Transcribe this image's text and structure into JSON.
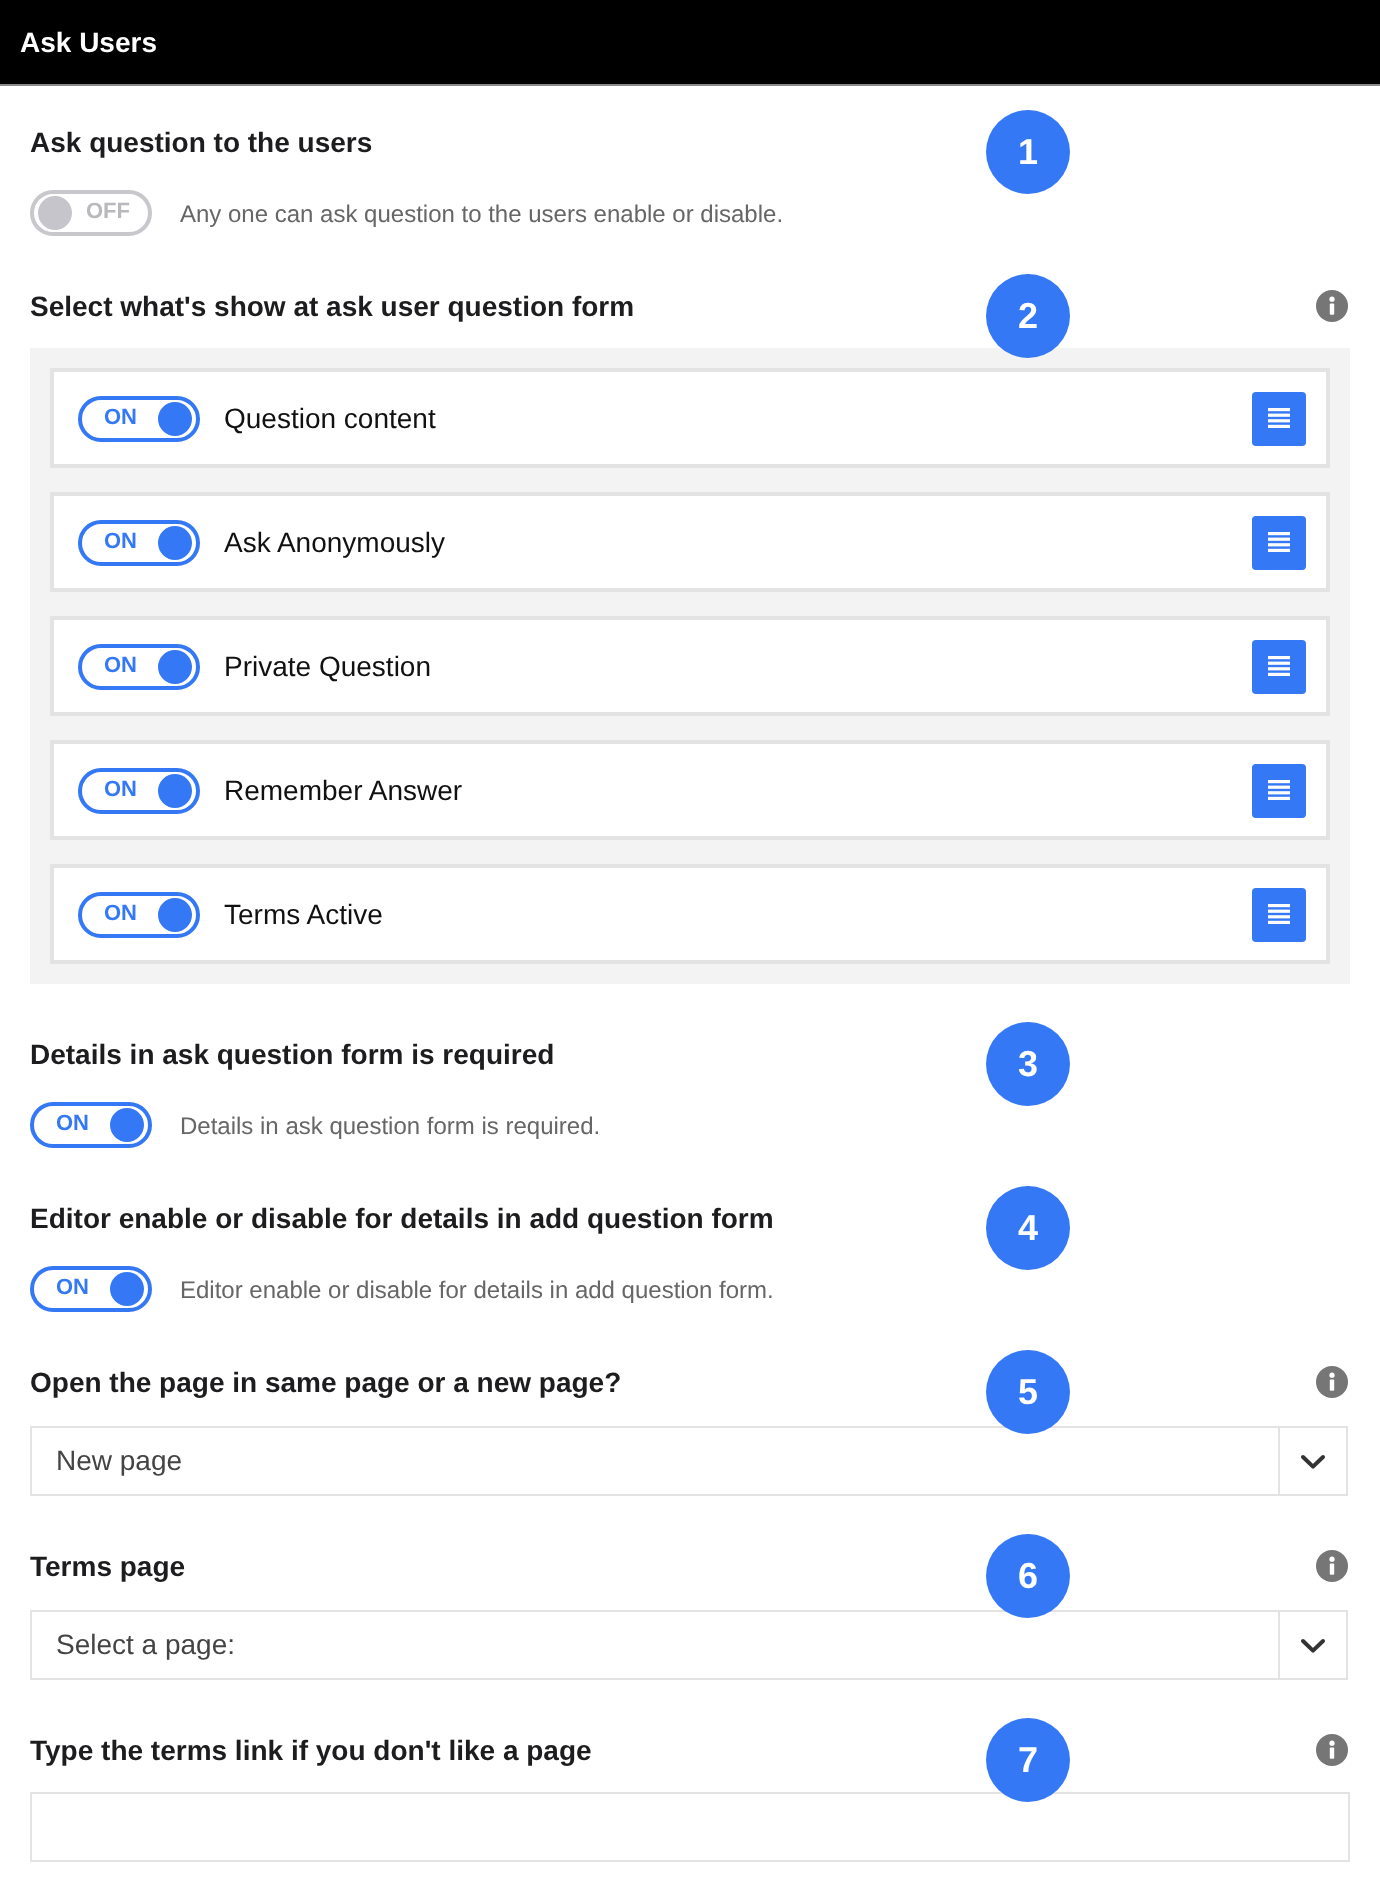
{
  "header": {
    "title": "Ask Users"
  },
  "sections": [
    {
      "kind": "switch",
      "title": "Ask question to the users",
      "callout": "1",
      "info": false,
      "toggle": {
        "on": false,
        "label": "OFF"
      },
      "description": "Any one can ask question to the users enable or disable."
    },
    {
      "kind": "switch_list",
      "title": "Select what's show at ask user question form",
      "callout": "2",
      "info": true,
      "items": [
        {
          "label": "Question content",
          "toggle": {
            "on": true,
            "label": "ON"
          }
        },
        {
          "label": "Ask Anonymously",
          "toggle": {
            "on": true,
            "label": "ON"
          }
        },
        {
          "label": "Private Question",
          "toggle": {
            "on": true,
            "label": "ON"
          }
        },
        {
          "label": "Remember Answer",
          "toggle": {
            "on": true,
            "label": "ON"
          }
        },
        {
          "label": "Terms Active",
          "toggle": {
            "on": true,
            "label": "ON"
          }
        }
      ]
    },
    {
      "kind": "switch",
      "title": "Details in ask question form is required",
      "callout": "3",
      "info": false,
      "toggle": {
        "on": true,
        "label": "ON"
      },
      "description": "Details in ask question form is required."
    },
    {
      "kind": "switch",
      "title": "Editor enable or disable for details in add question form",
      "callout": "4",
      "info": false,
      "toggle": {
        "on": true,
        "label": "ON"
      },
      "description": "Editor enable or disable for details in add question form."
    },
    {
      "kind": "select",
      "title": "Open the page in same page or a new page?",
      "callout": "5",
      "info": true,
      "value": "New page"
    },
    {
      "kind": "select",
      "title": "Terms page",
      "callout": "6",
      "info": true,
      "value": "Select a page:"
    },
    {
      "kind": "text_input",
      "title": "Type the terms link if you don't like a page",
      "callout": "7",
      "info": true
    }
  ]
}
